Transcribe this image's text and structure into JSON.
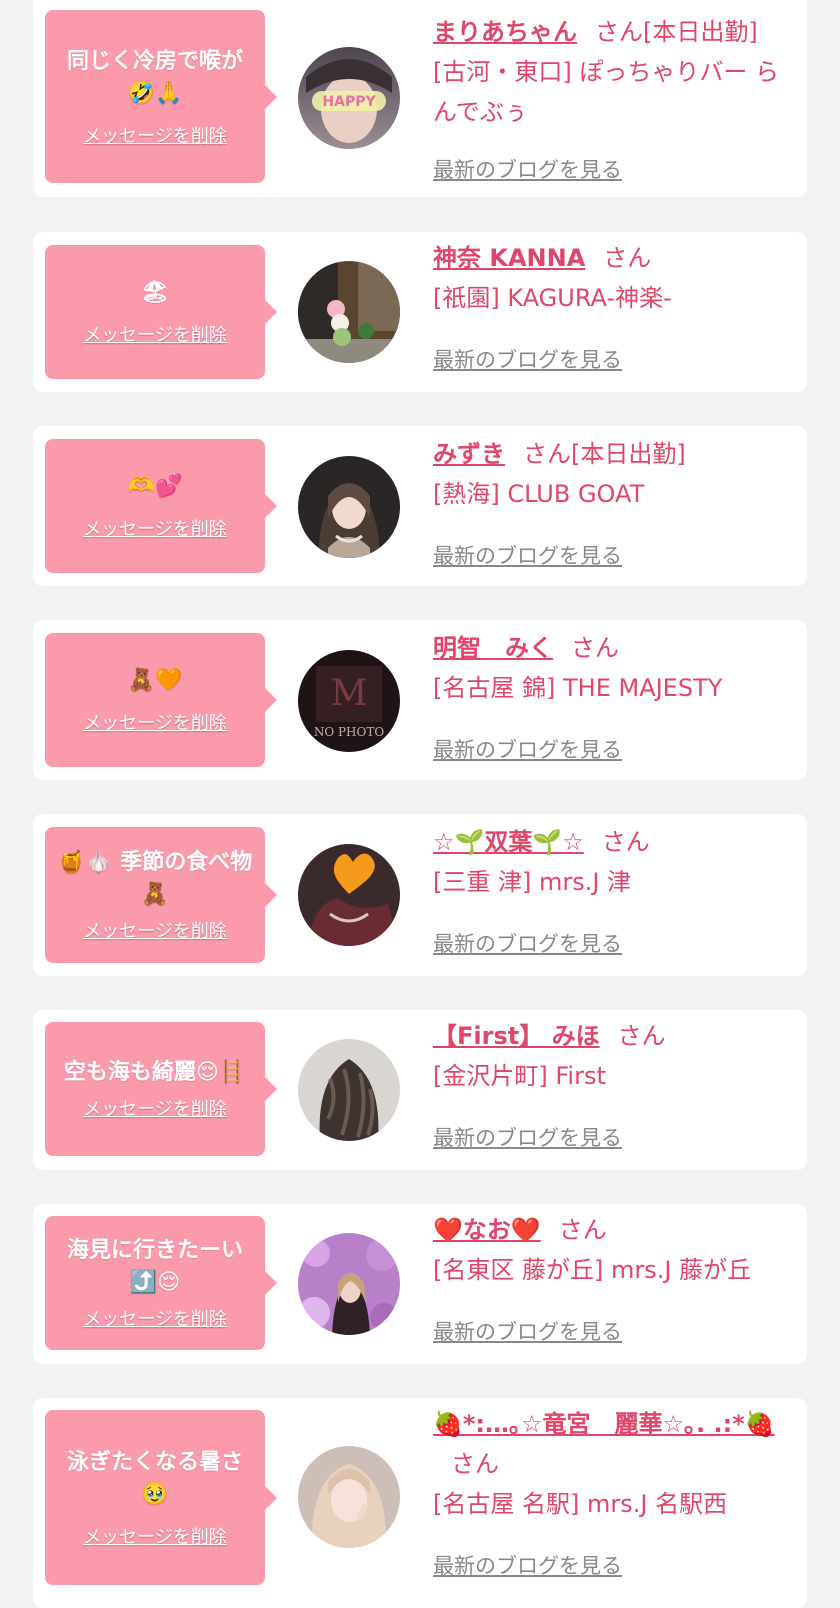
{
  "common": {
    "delete_label": "メッセージを削除",
    "blog_label": "最新のブログを見る",
    "san": "さん"
  },
  "colors": {
    "page_bg": "#f2f2f2",
    "card_bg": "#ffffff",
    "bubble_pink": "#fa9aab",
    "name_pink": "#e0456a",
    "link_gray": "#888888"
  },
  "entries": [
    {
      "message": "同じく冷房で喉が🤣🙏",
      "avatar_icon": "happy-sticker-avatar",
      "avatar_caption": "HAPPY",
      "name": "まりあちゃん",
      "suffix": "さん[本日出勤]",
      "shop": "[古河・東口] ぽっちゃりバー らんでぶぅ"
    },
    {
      "message": "🏖",
      "avatar_icon": "street-photo-avatar",
      "name": "神奈 KANNA",
      "suffix": "さん",
      "shop": "[祇園] KAGURA-神楽-"
    },
    {
      "message": "🫶💕",
      "avatar_icon": "girl-photo-avatar",
      "name": "みずき",
      "suffix": "さん[本日出勤]",
      "shop": "[熱海] CLUB GOAT"
    },
    {
      "message": "🧸🧡",
      "avatar_icon": "no-photo-avatar",
      "avatar_caption": "NO PHOTO",
      "name": "明智　みく",
      "suffix": "さん",
      "shop": "[名古屋 錦] THE MAJESTY"
    },
    {
      "message": "🍯🧄 季節の食べ物🧸",
      "avatar_icon": "heart-sticker-avatar",
      "name": "☆🌱双葉🌱☆",
      "suffix": "さん",
      "shop": "[三重 津] mrs.J 津"
    },
    {
      "message": "空も海も綺麗😌🪜",
      "avatar_icon": "hair-photo-avatar",
      "name": "【First】 みほ",
      "suffix": "さん",
      "shop": "[金沢片町] First"
    },
    {
      "message": "海見に行きたーい⤴️😌",
      "avatar_icon": "flower-photo-avatar",
      "name": "❤️なお❤️",
      "suffix": "さん",
      "shop": "[名東区 藤が丘] mrs.J 藤が丘"
    },
    {
      "message": "泳ぎたくなる暑さ🥹",
      "avatar_icon": "blonde-photo-avatar",
      "name": "🍓*:…｡☆竜宮　麗華☆｡. .:*🍓",
      "suffix": "さん",
      "shop": "[名古屋 名駅] mrs.J 名駅西"
    }
  ]
}
